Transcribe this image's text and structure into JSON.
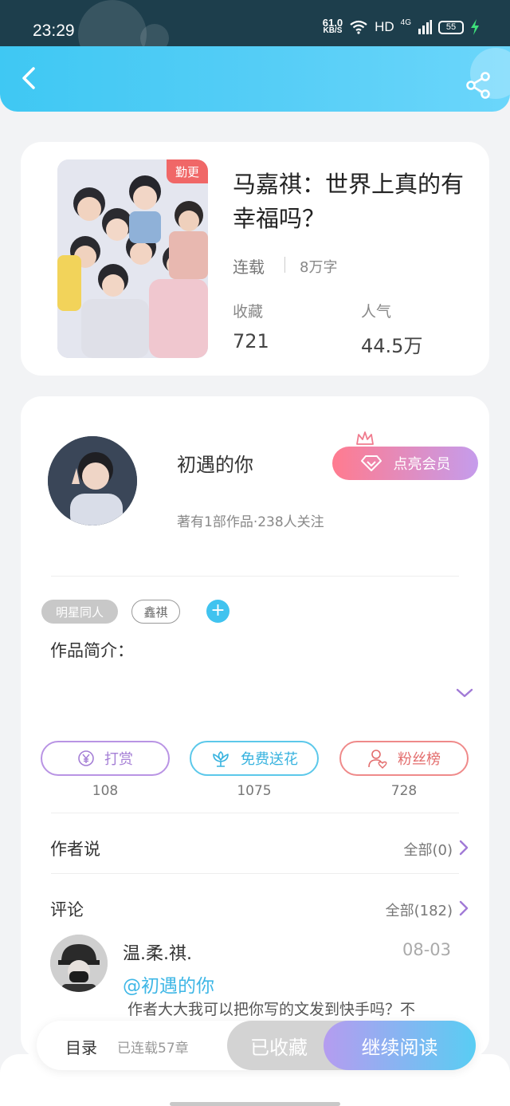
{
  "status_bar": {
    "time": "23:29",
    "net_speed_value": "61.0",
    "net_speed_unit": "KB/S",
    "hd": "HD",
    "signal": "4G",
    "battery": "55"
  },
  "header": {
    "back_icon": "chevron-left-icon",
    "share_icon": "share-icon",
    "gradient": [
      "#3fc8f3",
      "#6bd6fb"
    ]
  },
  "book": {
    "title": "马嘉祺：世界上真的有幸福吗？",
    "badge": "勤更",
    "status": "连载",
    "word_count": "8万字",
    "favorites_label": "收藏",
    "favorites_value": "721",
    "popularity_label": "人气",
    "popularity_value": "44.5万"
  },
  "author": {
    "name": "初遇的你",
    "meta": "著有1部作品·238人关注",
    "vip_button": "点亮会员"
  },
  "tags": [
    "明星同人",
    "鑫祺"
  ],
  "intro_label": "作品简介：",
  "actions": [
    {
      "label": "打赏",
      "count": "108",
      "icon": "yen-icon"
    },
    {
      "label": "免费送花",
      "count": "1075",
      "icon": "flower-icon"
    },
    {
      "label": "粉丝榜",
      "count": "728",
      "icon": "fan-icon"
    }
  ],
  "author_says": {
    "label": "作者说",
    "link": "全部(0)"
  },
  "comments": {
    "label": "评论",
    "link": "全部(182)",
    "first": {
      "user": "温.柔.祺.",
      "date": "08-03",
      "mention": "@初遇的你",
      "text": "作者大大我可以把你写的文发到快手吗？不"
    }
  },
  "bottom_bar": {
    "toc": "目录",
    "chapters": "已连载57章",
    "collected": "已收藏",
    "continue": "继续阅读"
  },
  "colors": {
    "accent_blue": "#40c3ef",
    "badge_red": "#f06767",
    "reward_purple": "#a57fd6",
    "fans_red": "#e36d6d"
  }
}
